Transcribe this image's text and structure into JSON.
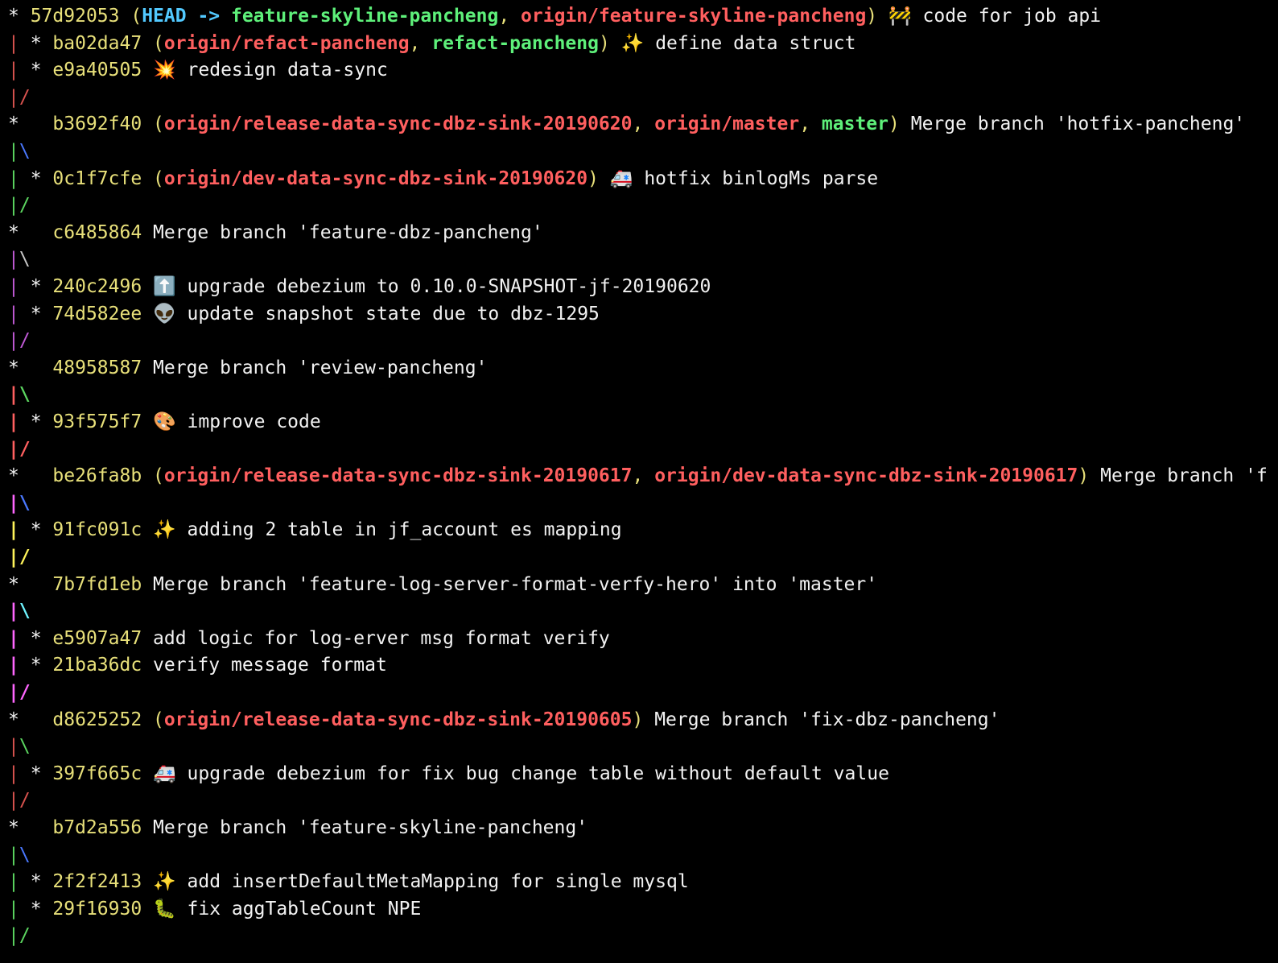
{
  "colors": {
    "background": "#000000",
    "text": "#f2f2f2",
    "hash": "#e8e07a",
    "head": "#52c9ff",
    "local_branch": "#5ef07a",
    "remote_branch": "#ff5f5f",
    "graph_red": "#d9534f",
    "graph_magenta": "#c05ad6",
    "graph_bright_red": "#ff6060",
    "graph_bright_magenta": "#ff66ff",
    "graph_bright_yellow": "#fff45a",
    "graph_bright_cyan": "#6ff4ff",
    "graph_green": "#5cd660",
    "graph_blue": "#4a78ff",
    "graph_gray": "#c8c8c8"
  },
  "log": [
    {
      "type": "commit",
      "graph": [
        {
          "t": "* ",
          "c": "text"
        }
      ],
      "hash": "57d92053",
      "refs": [
        {
          "t": "HEAD -> ",
          "c": "head"
        },
        {
          "t": "feature-skyline-pancheng",
          "c": "local_branch"
        },
        {
          "t": ", ",
          "c": "hash"
        },
        {
          "t": "origin/feature-skyline-pancheng",
          "c": "remote_branch"
        }
      ],
      "icon": "construction-icon",
      "emoji": "🚧",
      "message": "code for job api"
    },
    {
      "type": "commit",
      "graph": [
        {
          "t": "| ",
          "c": "graph_red"
        },
        {
          "t": "* ",
          "c": "text"
        }
      ],
      "hash": "ba02da47",
      "refs": [
        {
          "t": "origin/refact-pancheng",
          "c": "remote_branch"
        },
        {
          "t": ", ",
          "c": "hash"
        },
        {
          "t": "refact-pancheng",
          "c": "local_branch"
        }
      ],
      "icon": "sparkles-icon",
      "emoji": "✨",
      "message": "define data struct"
    },
    {
      "type": "commit",
      "graph": [
        {
          "t": "| ",
          "c": "graph_red"
        },
        {
          "t": "* ",
          "c": "text"
        }
      ],
      "hash": "e9a40505",
      "refs": [],
      "icon": "boom-icon",
      "emoji": "💥",
      "message": "redesign data-sync"
    },
    {
      "type": "graph",
      "graph": [
        {
          "t": "|/",
          "c": "graph_red"
        }
      ]
    },
    {
      "type": "commit",
      "graph": [
        {
          "t": "*   ",
          "c": "text"
        }
      ],
      "hash": "b3692f40",
      "refs": [
        {
          "t": "origin/release-data-sync-dbz-sink-20190620",
          "c": "remote_branch"
        },
        {
          "t": ", ",
          "c": "hash"
        },
        {
          "t": "origin/master",
          "c": "remote_branch"
        },
        {
          "t": ", ",
          "c": "hash"
        },
        {
          "t": "master",
          "c": "local_branch"
        }
      ],
      "icon": "",
      "emoji": "",
      "message": "Merge branch 'hotfix-pancheng'"
    },
    {
      "type": "graph",
      "graph": [
        {
          "t": "|",
          "c": "graph_green"
        },
        {
          "t": "\\",
          "c": "graph_blue"
        }
      ]
    },
    {
      "type": "commit",
      "graph": [
        {
          "t": "| ",
          "c": "graph_green"
        },
        {
          "t": "* ",
          "c": "text"
        }
      ],
      "hash": "0c1f7cfe",
      "refs": [
        {
          "t": "origin/dev-data-sync-dbz-sink-20190620",
          "c": "remote_branch"
        }
      ],
      "icon": "ambulance-icon",
      "emoji": "🚑",
      "message": "hotfix binlogMs parse"
    },
    {
      "type": "graph",
      "graph": [
        {
          "t": "|/",
          "c": "graph_green"
        }
      ]
    },
    {
      "type": "commit",
      "graph": [
        {
          "t": "*   ",
          "c": "text"
        }
      ],
      "hash": "c6485864",
      "refs": [],
      "icon": "",
      "emoji": "",
      "message": "Merge branch 'feature-dbz-pancheng'"
    },
    {
      "type": "graph",
      "graph": [
        {
          "t": "|",
          "c": "graph_magenta"
        },
        {
          "t": "\\",
          "c": "graph_gray"
        }
      ]
    },
    {
      "type": "commit",
      "graph": [
        {
          "t": "| ",
          "c": "graph_magenta"
        },
        {
          "t": "* ",
          "c": "text"
        }
      ],
      "hash": "240c2496",
      "refs": [],
      "icon": "arrow-up-icon",
      "emoji": "⬆️",
      "message": "upgrade debezium to 0.10.0-SNAPSHOT-jf-20190620"
    },
    {
      "type": "commit",
      "graph": [
        {
          "t": "| ",
          "c": "graph_magenta"
        },
        {
          "t": "* ",
          "c": "text"
        }
      ],
      "hash": "74d582ee",
      "refs": [],
      "icon": "alien-icon",
      "emoji": "👽",
      "message": "update snapshot state due to dbz-1295"
    },
    {
      "type": "graph",
      "graph": [
        {
          "t": "|/",
          "c": "graph_magenta"
        }
      ]
    },
    {
      "type": "commit",
      "graph": [
        {
          "t": "*   ",
          "c": "text"
        }
      ],
      "hash": "48958587",
      "refs": [],
      "icon": "",
      "emoji": "",
      "message": "Merge branch 'review-pancheng'"
    },
    {
      "type": "graph",
      "graph": [
        {
          "t": "|",
          "c": "graph_bright_red",
          "b": true
        },
        {
          "t": "\\",
          "c": "graph_green",
          "b": true
        }
      ]
    },
    {
      "type": "commit",
      "graph": [
        {
          "t": "| ",
          "c": "graph_bright_red",
          "b": true
        },
        {
          "t": "* ",
          "c": "text"
        }
      ],
      "hash": "93f575f7",
      "refs": [],
      "icon": "palette-icon",
      "emoji": "🎨",
      "message": "improve code"
    },
    {
      "type": "graph",
      "graph": [
        {
          "t": "|/",
          "c": "graph_bright_red",
          "b": true
        }
      ]
    },
    {
      "type": "commit",
      "graph": [
        {
          "t": "*   ",
          "c": "text"
        }
      ],
      "hash": "be26fa8b",
      "refs": [
        {
          "t": "origin/release-data-sync-dbz-sink-20190617",
          "c": "remote_branch"
        },
        {
          "t": ", ",
          "c": "hash"
        },
        {
          "t": "origin/dev-data-sync-dbz-sink-20190617",
          "c": "remote_branch"
        }
      ],
      "icon": "",
      "emoji": "",
      "message": "Merge branch 'f"
    },
    {
      "type": "graph",
      "graph": [
        {
          "t": "|",
          "c": "graph_bright_magenta",
          "b": true
        },
        {
          "t": "\\",
          "c": "graph_blue",
          "b": true
        }
      ]
    },
    {
      "type": "commit",
      "graph": [
        {
          "t": "| ",
          "c": "graph_bright_yellow",
          "b": true
        },
        {
          "t": "* ",
          "c": "text"
        }
      ],
      "hash": "91fc091c",
      "refs": [],
      "icon": "sparkles-icon",
      "emoji": "✨",
      "message": "adding 2 table in jf_account es mapping"
    },
    {
      "type": "graph",
      "graph": [
        {
          "t": "|/",
          "c": "graph_bright_yellow",
          "b": true
        }
      ]
    },
    {
      "type": "commit",
      "graph": [
        {
          "t": "*   ",
          "c": "text"
        }
      ],
      "hash": "7b7fd1eb",
      "refs": [],
      "icon": "",
      "emoji": "",
      "message": "Merge branch 'feature-log-server-format-verfy-hero' into 'master'"
    },
    {
      "type": "graph",
      "graph": [
        {
          "t": "|",
          "c": "graph_bright_magenta",
          "b": true
        },
        {
          "t": "\\",
          "c": "graph_bright_cyan",
          "b": true
        }
      ]
    },
    {
      "type": "commit",
      "graph": [
        {
          "t": "| ",
          "c": "graph_bright_magenta",
          "b": true
        },
        {
          "t": "* ",
          "c": "text"
        }
      ],
      "hash": "e5907a47",
      "refs": [],
      "icon": "",
      "emoji": "",
      "message": "add logic for log-erver msg format verify"
    },
    {
      "type": "commit",
      "graph": [
        {
          "t": "| ",
          "c": "graph_bright_magenta",
          "b": true
        },
        {
          "t": "* ",
          "c": "text"
        }
      ],
      "hash": "21ba36dc",
      "refs": [],
      "icon": "",
      "emoji": "",
      "message": "verify message format"
    },
    {
      "type": "graph",
      "graph": [
        {
          "t": "|/",
          "c": "graph_bright_magenta",
          "b": true
        }
      ]
    },
    {
      "type": "commit",
      "graph": [
        {
          "t": "*   ",
          "c": "text"
        }
      ],
      "hash": "d8625252",
      "refs": [
        {
          "t": "origin/release-data-sync-dbz-sink-20190605",
          "c": "remote_branch"
        }
      ],
      "icon": "",
      "emoji": "",
      "message": "Merge branch 'fix-dbz-pancheng'"
    },
    {
      "type": "graph",
      "graph": [
        {
          "t": "|",
          "c": "graph_red"
        },
        {
          "t": "\\",
          "c": "graph_green"
        }
      ]
    },
    {
      "type": "commit",
      "graph": [
        {
          "t": "| ",
          "c": "graph_red"
        },
        {
          "t": "* ",
          "c": "text"
        }
      ],
      "hash": "397f665c",
      "refs": [],
      "icon": "ambulance-icon",
      "emoji": "🚑",
      "message": "upgrade debezium for fix bug change table without default value"
    },
    {
      "type": "graph",
      "graph": [
        {
          "t": "|/",
          "c": "graph_red"
        }
      ]
    },
    {
      "type": "commit",
      "graph": [
        {
          "t": "*   ",
          "c": "text"
        }
      ],
      "hash": "b7d2a556",
      "refs": [],
      "icon": "",
      "emoji": "",
      "message": "Merge branch 'feature-skyline-pancheng'"
    },
    {
      "type": "graph",
      "graph": [
        {
          "t": "|",
          "c": "graph_green"
        },
        {
          "t": "\\",
          "c": "graph_blue"
        }
      ]
    },
    {
      "type": "commit",
      "graph": [
        {
          "t": "| ",
          "c": "graph_green"
        },
        {
          "t": "* ",
          "c": "text"
        }
      ],
      "hash": "2f2f2413",
      "refs": [],
      "icon": "sparkles-icon",
      "emoji": "✨",
      "message": "add insertDefaultMetaMapping for single mysql"
    },
    {
      "type": "commit",
      "graph": [
        {
          "t": "| ",
          "c": "graph_green"
        },
        {
          "t": "* ",
          "c": "text"
        }
      ],
      "hash": "29f16930",
      "refs": [],
      "icon": "bug-icon",
      "emoji": "🐛",
      "message": "fix aggTableCount NPE"
    },
    {
      "type": "graph",
      "graph": [
        {
          "t": "|/",
          "c": "graph_green"
        }
      ]
    }
  ]
}
